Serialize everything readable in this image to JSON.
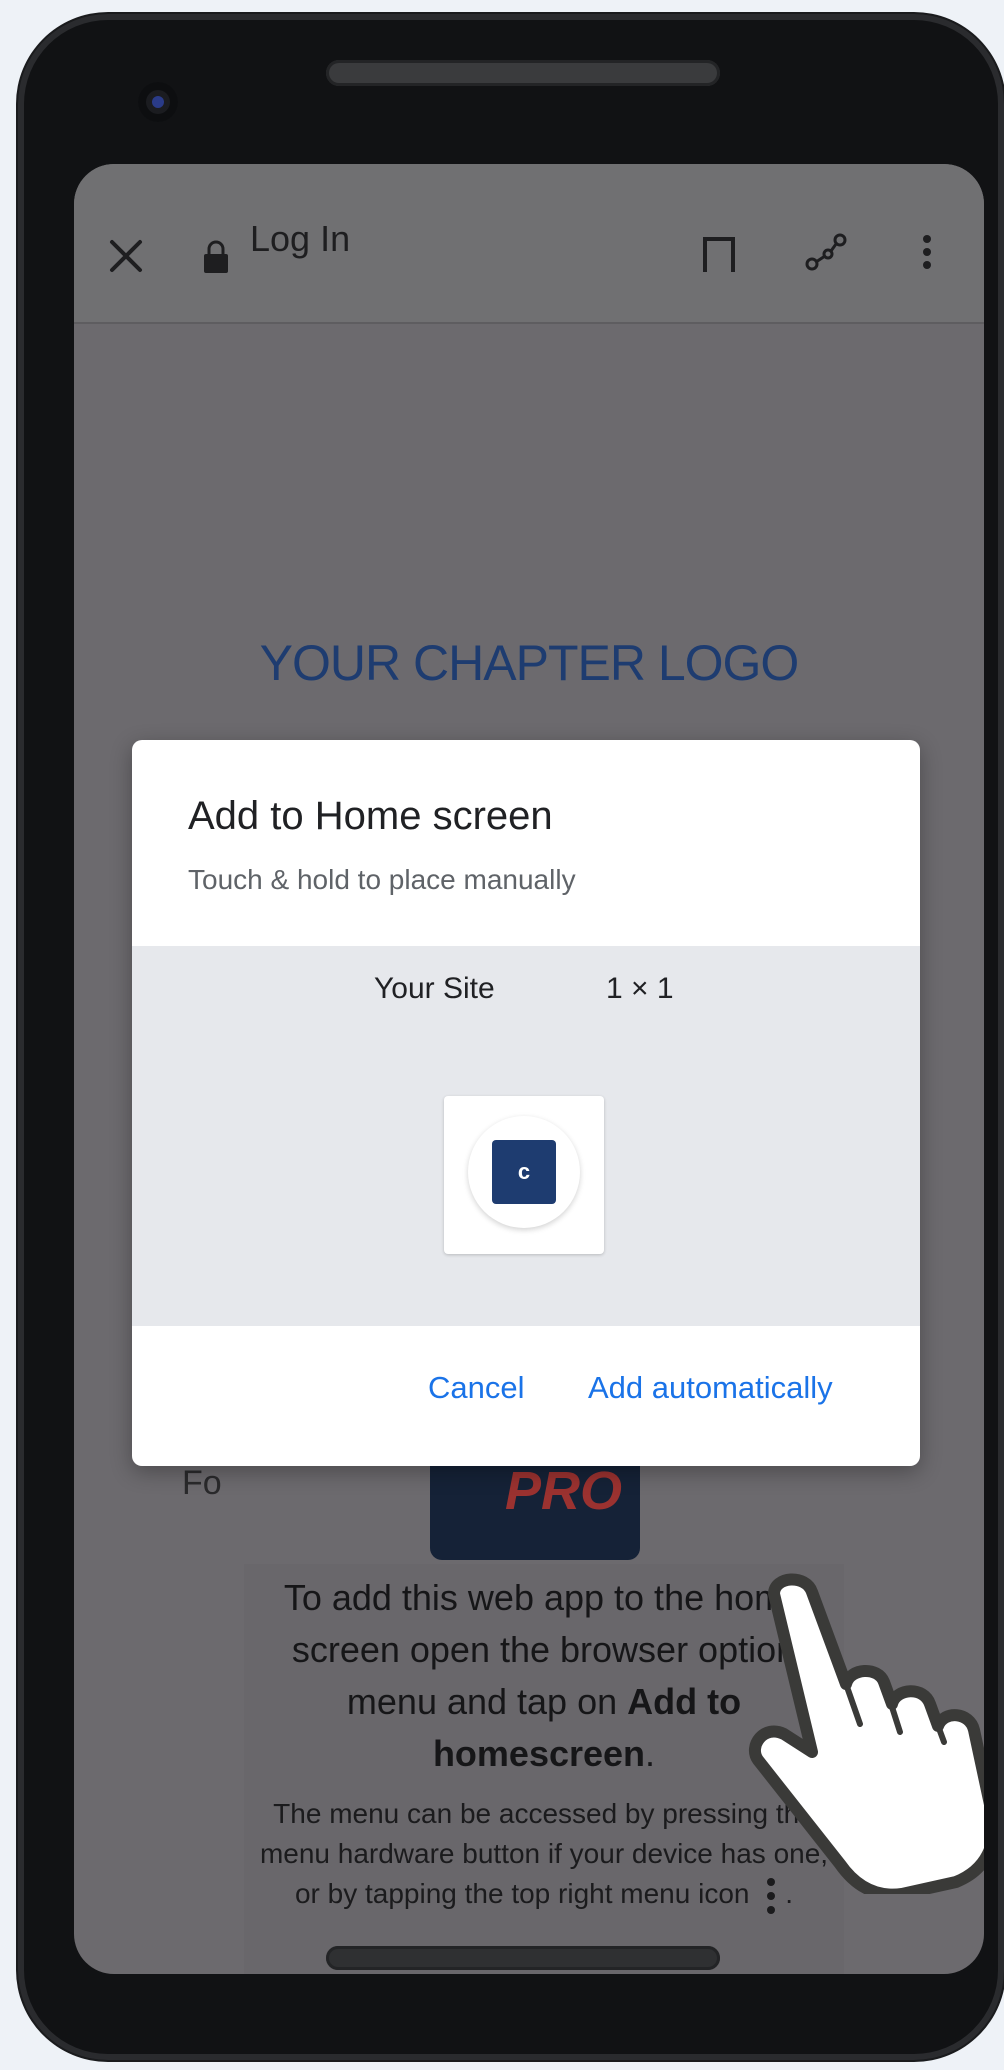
{
  "browser": {
    "title": "Log In",
    "close_icon": "close-icon",
    "lock_icon": "lock-icon",
    "bookmark_icon": "bookmark-icon",
    "share_icon": "share-icon",
    "menu_icon": "more-vertical-icon"
  },
  "page": {
    "logo_text": "YOUR CHAPTER LOGO",
    "side_text": "Fo",
    "pro_label": "PRO",
    "instructions_main_1": "To add this web app to the home screen open the browser option menu and tap on ",
    "instructions_bold": "Add to homescreen",
    "instructions_main_2": ".",
    "instructions_sub": "The menu can be accessed by pressing the menu hardware button if your device has one, or by tapping the top right menu icon",
    "instructions_sub_end": "."
  },
  "dialog": {
    "title": "Add to Home screen",
    "subtitle": "Touch & hold to place manually",
    "site_name": "Your Site",
    "site_size": "1 × 1",
    "app_letter": "c",
    "cancel_label": "Cancel",
    "add_label": "Add automatically"
  },
  "colors": {
    "accent": "#1a73e8",
    "logo": "#1e3c70",
    "overlay": "#6c6a6e"
  },
  "overlay_icon": "pointing-hand-icon"
}
